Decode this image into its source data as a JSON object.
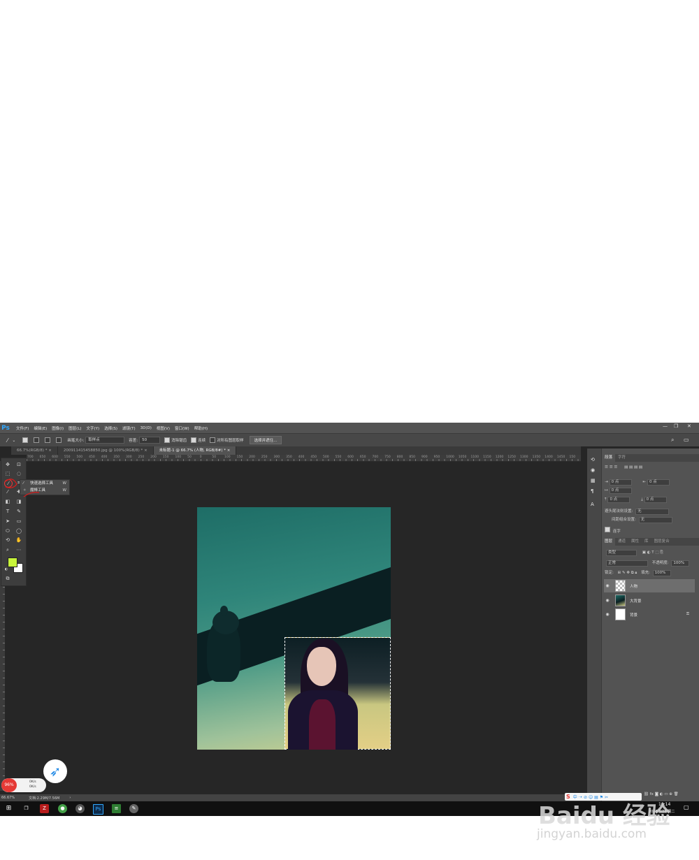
{
  "app": {
    "logo": "Ps",
    "menu": [
      "文件(F)",
      "编辑(E)",
      "图像(I)",
      "图层(L)",
      "文字(Y)",
      "选择(S)",
      "滤镜(T)",
      "3D(D)",
      "视图(V)",
      "窗口(W)",
      "帮助(H)"
    ]
  },
  "options": {
    "brush_label": "画笔大小:",
    "brush_value": "取样点",
    "tolerance_label": "容差:",
    "tolerance_value": "50",
    "antialias_label": "消除锯齿",
    "contiguous_label": "连续",
    "sample_all_label": "对所有图层取样",
    "refine_button": "选择并遮住..."
  },
  "tabs": [
    {
      "label": "66.7%(RGB/8) *",
      "close": "×"
    },
    {
      "label": "200911415458850.jpg @ 100%(RGB/8) *",
      "close": "×"
    },
    {
      "label": "未标题-1 @ 66.7% (人物, RGB/8#) *",
      "close": "×"
    }
  ],
  "ruler_labels": [
    "700",
    "650",
    "600",
    "550",
    "500",
    "450",
    "400",
    "350",
    "300",
    "250",
    "200",
    "150",
    "100",
    "50",
    "0",
    "50",
    "100",
    "150",
    "200",
    "250",
    "300",
    "350",
    "400",
    "450",
    "500",
    "550",
    "600",
    "650",
    "700",
    "750",
    "800",
    "850",
    "900",
    "950",
    "1000",
    "1050",
    "1100",
    "1150",
    "1200",
    "1250",
    "1300",
    "1350",
    "1400",
    "1450",
    "150"
  ],
  "flyout": [
    {
      "label": "快速选择工具",
      "key": "W"
    },
    {
      "label": "魔棒工具",
      "key": "W"
    }
  ],
  "colors": {
    "foreground": "#c8f53a",
    "background": "#ffffff"
  },
  "paragraph_panel": {
    "tabs": [
      "段落",
      "字符"
    ],
    "indent_left": "0 点",
    "indent_right": "0 点",
    "indent_first": "0 点",
    "space_before": "0 点",
    "space_after": "0 点",
    "rule_label": "避头尾法则设置:",
    "rule_value": "无",
    "spacing_label": "间距组合设置:",
    "spacing_value": "无",
    "hyphen_label": "连字"
  },
  "layers_panel": {
    "tabs": [
      "图层",
      "通道",
      "属性",
      "库",
      "图层复合"
    ],
    "filter": "类型",
    "blend": "正常",
    "opacity_label": "不透明度:",
    "opacity_value": "100%",
    "lock_label": "锁定:",
    "fill_label": "填充:",
    "fill_value": "100%",
    "layers": [
      {
        "name": "人物",
        "selected": true
      },
      {
        "name": "大背景",
        "selected": false
      },
      {
        "name": "背景",
        "selected": false,
        "locked": true
      }
    ]
  },
  "status": {
    "zoom": "66.67%",
    "doc": "文档:2.29M/7.56M",
    "monitor_pct": "96%",
    "up": "0K/s",
    "down": "0K/s"
  },
  "taskbar": {
    "time": "10:14",
    "date": "2016/3/29/周二"
  },
  "watermark": {
    "main": "Baidu 经验",
    "sub": "jingyan.baidu.com"
  }
}
